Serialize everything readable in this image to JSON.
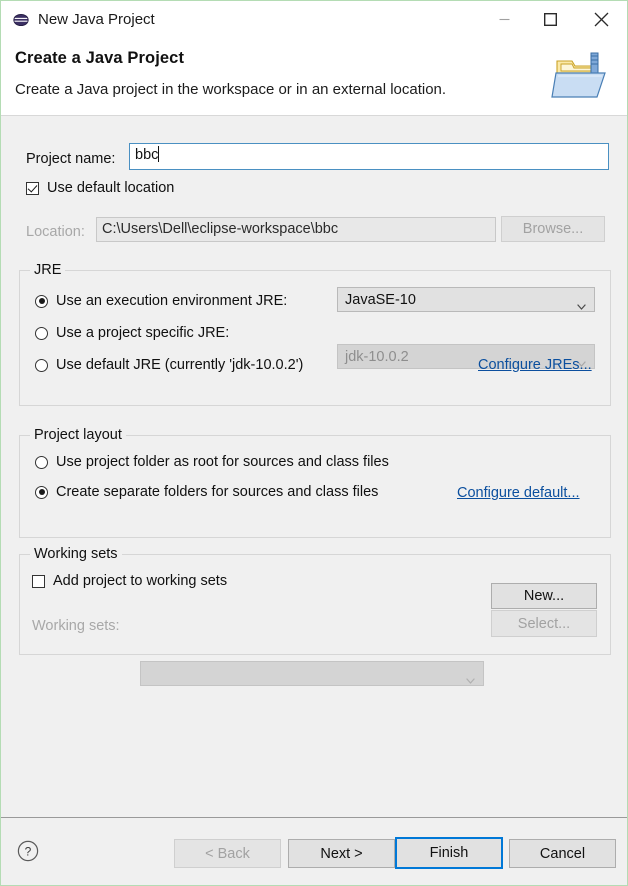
{
  "window": {
    "title": "New Java Project",
    "icon": "eclipse-sphere-icon",
    "controls": {
      "minimize": "minimize-icon",
      "maximize": "maximize-icon",
      "close": "close-icon"
    }
  },
  "header": {
    "title": "Create a Java Project",
    "subtitle": "Create a Java project in the workspace or in an external location.",
    "icon": "java-project-folder-icon"
  },
  "project": {
    "name_label": "Project name:",
    "name_value": "bbc",
    "use_default_location_label": "Use default location",
    "use_default_location_checked": true,
    "location_label": "Location:",
    "location_value": "C:\\Users\\Dell\\eclipse-workspace\\bbc",
    "location_enabled": false,
    "browse_label": "Browse...",
    "browse_enabled": false
  },
  "jre": {
    "group_title": "JRE",
    "options": [
      {
        "label": "Use an execution environment JRE:",
        "selected": true,
        "combo_value": "JavaSE-10",
        "combo_enabled": true
      },
      {
        "label": "Use a project specific JRE:",
        "selected": false,
        "combo_value": "jdk-10.0.2",
        "combo_enabled": false
      },
      {
        "label": "Use default JRE (currently 'jdk-10.0.2')",
        "selected": false
      }
    ],
    "configure_link": "Configure JREs..."
  },
  "project_layout": {
    "group_title": "Project layout",
    "options": [
      {
        "label": "Use project folder as root for sources and class files",
        "selected": false
      },
      {
        "label": "Create separate folders for sources and class files",
        "selected": true
      }
    ],
    "configure_link": "Configure default..."
  },
  "working_sets": {
    "group_title": "Working sets",
    "add_label": "Add project to working sets",
    "add_checked": false,
    "new_label": "New...",
    "sets_label": "Working sets:",
    "sets_value": "",
    "sets_enabled": false,
    "select_label": "Select...",
    "select_enabled": false
  },
  "footer": {
    "help_icon": "help-icon",
    "back_label": "< Back",
    "back_enabled": false,
    "next_label": "Next >",
    "next_enabled": true,
    "finish_label": "Finish",
    "finish_default": true,
    "cancel_label": "Cancel"
  },
  "colors": {
    "accent": "#0078d7",
    "link": "#0b4f9e",
    "dialog_bg": "#f0f0f0",
    "field_focus_border": "#4a90c2"
  }
}
